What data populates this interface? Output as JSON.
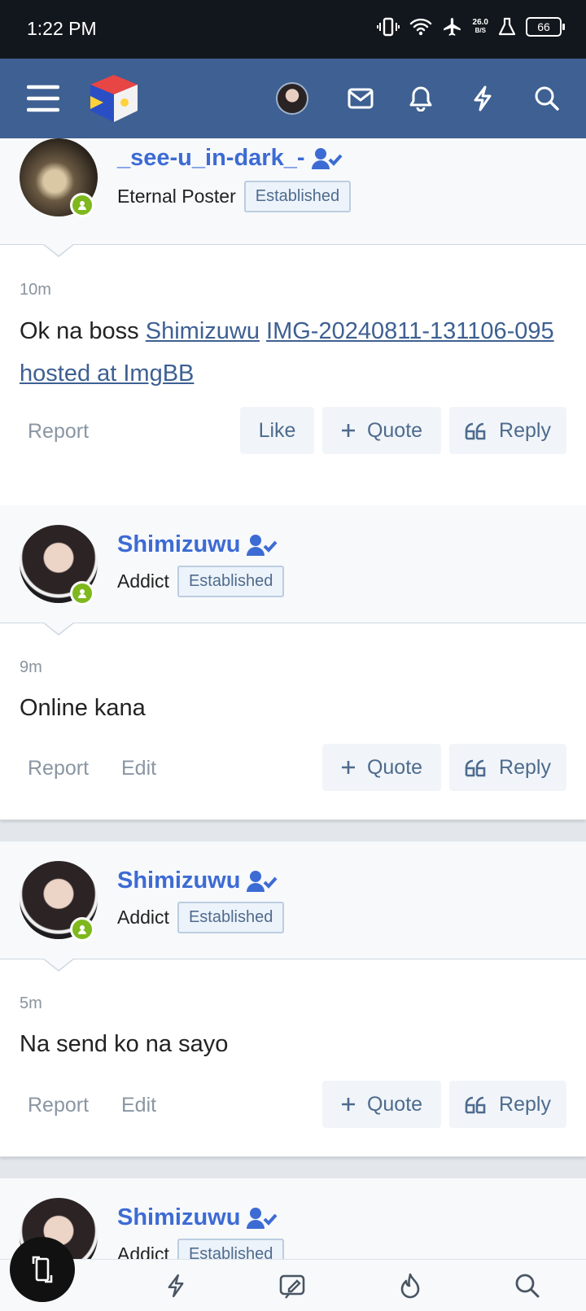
{
  "status_bar": {
    "time": "1:22 PM",
    "net_speed_value": "26.0",
    "net_speed_unit": "B/S",
    "battery": "66"
  },
  "posts": [
    {
      "username": "_see-u_in-dark_-",
      "user_title": "Eternal Poster",
      "badge": "Established",
      "time": "10m",
      "body_text": "Ok na boss ",
      "body_link_1": "Shimizuwu",
      "body_link_2": "IMG-20240811-131106-095 hosted at ImgBB",
      "actions": [
        "Report"
      ],
      "buttons": {
        "like": "Like",
        "quote": "Quote",
        "reply": "Reply"
      }
    },
    {
      "username": "Shimizuwu",
      "user_title": "Addict",
      "badge": "Established",
      "time": "9m",
      "body_text": "Online kana",
      "actions": [
        "Report",
        "Edit"
      ],
      "buttons": {
        "quote": "Quote",
        "reply": "Reply"
      }
    },
    {
      "username": "Shimizuwu",
      "user_title": "Addict",
      "badge": "Established",
      "time": "5m",
      "body_text": "Na send ko na sayo",
      "actions": [
        "Report",
        "Edit"
      ],
      "buttons": {
        "quote": "Quote",
        "reply": "Reply"
      }
    },
    {
      "username": "Shimizuwu",
      "user_title": "Addict",
      "badge": "Established"
    }
  ],
  "colors": {
    "nav_bg": "#3e6092",
    "username": "#3d6bd4",
    "online": "#7fb81d"
  },
  "icons": {
    "nav": [
      "menu-icon",
      "site-logo",
      "user-avatar",
      "mail-icon",
      "bell-icon",
      "bolt-icon",
      "search-icon"
    ],
    "bottom": [
      "bolt-icon",
      "compose-icon",
      "fire-icon",
      "search-icon"
    ]
  }
}
